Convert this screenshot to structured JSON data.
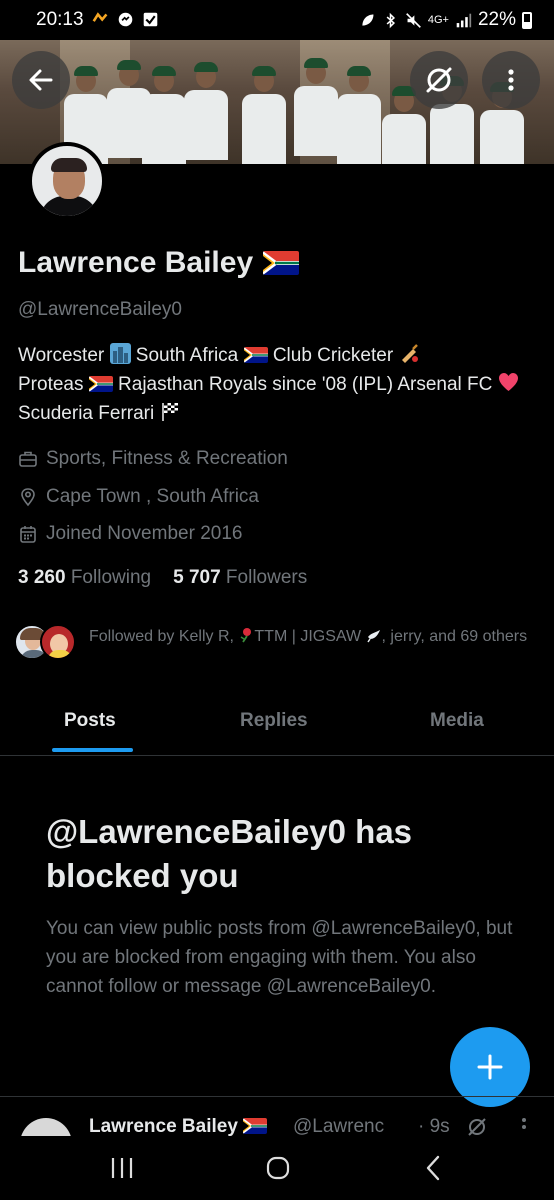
{
  "status_bar": {
    "time": "20:13",
    "battery": "22%",
    "network": "4G+"
  },
  "banner": {
    "back_icon": "arrow-left-icon",
    "grok_icon": "grok-icon",
    "more_icon": "more-vertical-icon"
  },
  "profile": {
    "name": "Lawrence Bailey",
    "handle": "@LawrenceBailey0",
    "bio": {
      "part1": "Worcester",
      "part2": "South Africa",
      "part3": "Club Cricketer",
      "part4": "Proteas",
      "part5": "Rajasthan Royals since '08 (IPL)  Arsenal FC",
      "part6": "Scuderia Ferrari"
    },
    "category": "Sports, Fitness & Recreation",
    "location": "Cape Town , South Africa",
    "joined": "Joined November 2016",
    "following_count": "3 260",
    "following_label": "Following",
    "followers_count": "5 707",
    "followers_label": "Followers",
    "followed_by": {
      "prefix": "Followed by Kelly R,",
      "ttm": "TTM | JIGSAW",
      "suffix": ", jerry, and 69 others"
    }
  },
  "tabs": [
    {
      "label": "Posts",
      "active": true
    },
    {
      "label": "Replies",
      "active": false
    },
    {
      "label": "Media",
      "active": false
    }
  ],
  "blocked": {
    "title": "@LawrenceBailey0 has blocked you",
    "body": "You can view public posts from @LawrenceBailey0, but you are blocked from engaging with them. You also cannot follow or message @LawrenceBailey0."
  },
  "post_preview": {
    "name": "Lawrence Bailey",
    "handle": "@Lawrenc",
    "time": "· 9s"
  },
  "colors": {
    "accent": "#1d9bf0",
    "background": "#000000",
    "text_primary": "#e7e9ea",
    "text_secondary": "#71767b"
  }
}
